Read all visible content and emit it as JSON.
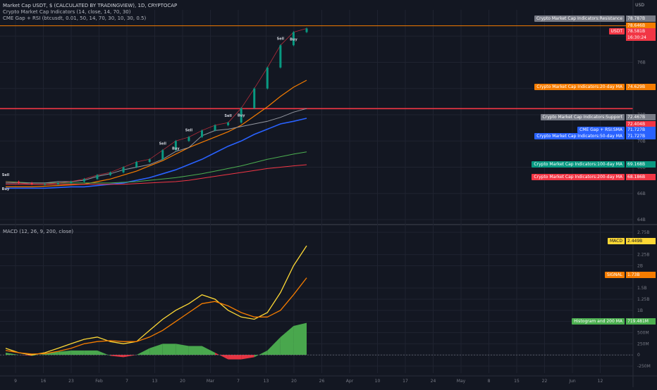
{
  "header": {
    "title": "Market Cap USDT, $ (CALCULATED BY TRADINGVIEW), 1D, CRYPTOCAP",
    "indicator_1": "Crypto Market Cap Indicators (14, close, 14, 70, 30)",
    "indicator_2": "CME Gap + RSI (btcusdt, 0.01, 50, 14, 70, 30, 10, 30, 0.5)",
    "currency": "USD",
    "macd_legend": "MACD (12, 26, 9, 200, close)"
  },
  "price_axis": {
    "ticks": [
      "78B",
      "76B",
      "74B",
      "72B",
      "70B",
      "68B",
      "66B",
      "64B"
    ],
    "labels": [
      {
        "name": "Crypto Market Cap Indicators:Resistance",
        "value": "78.787B",
        "color": "#b2b5be"
      },
      {
        "name": "",
        "value": "78.646B",
        "color": "#f57c00"
      },
      {
        "name": "USDT",
        "value": "78.581B",
        "sub": "16:30:24",
        "color": "#f23645"
      },
      {
        "name": "Crypto Market Cap Indicators:20-day MA",
        "value": "74.629B",
        "color": "#f57c00"
      },
      {
        "name": "Crypto Market Cap Indicators:Support",
        "value": "72.467B",
        "color": "#b2b5be"
      },
      {
        "name": "",
        "value": "72.404B",
        "color": "#f23645"
      },
      {
        "name": "CME Gap + RSI:SMA",
        "value": "71.727B",
        "color": "#2962ff"
      },
      {
        "name": "Crypto Market Cap Indicators:50-day MA",
        "value": "71.727B",
        "color": "#2962ff"
      },
      {
        "name": "Crypto Market Cap Indicators:100-day MA",
        "value": "69.168B",
        "color": "#089981"
      },
      {
        "name": "Crypto Market Cap Indicators:200-day MA",
        "value": "68.186B",
        "color": "#f23645"
      }
    ]
  },
  "macd_axis": {
    "ticks": [
      "2.75B",
      "2.25B",
      "2B",
      "1.5B",
      "1.25B",
      "1B",
      "750M",
      "500M",
      "250M",
      "0",
      "-250M"
    ],
    "labels": [
      {
        "name": "MACD",
        "value": "2.449B",
        "color": "#fdd835"
      },
      {
        "name": "SIGNAL",
        "value": "1.73B",
        "color": "#f57c00"
      },
      {
        "name": "Histogram and 200 MA",
        "value": "719.481M",
        "color": "#4caf50"
      }
    ]
  },
  "time_axis": {
    "labels": [
      "9",
      "16",
      "23",
      "Feb",
      "7",
      "13",
      "20",
      "Mar",
      "7",
      "13",
      "20",
      "26",
      "Apr",
      "10",
      "17",
      "24",
      "May",
      "8",
      "15",
      "22",
      "Jun",
      "12"
    ]
  },
  "signals": {
    "buy": "Buy",
    "sell": "Sell"
  },
  "chart_data": [
    {
      "type": "line",
      "title": "Market Cap USDT",
      "ylabel": "USD",
      "ylim": [
        64,
        80
      ],
      "x": [
        "Jan 6",
        "Jan 9",
        "Jan 12",
        "Jan 16",
        "Jan 19",
        "Jan 23",
        "Jan 26",
        "Feb 1",
        "Feb 4",
        "Feb 7",
        "Feb 10",
        "Feb 13",
        "Feb 16",
        "Feb 20",
        "Feb 23",
        "Mar 1",
        "Mar 4",
        "Mar 7",
        "Mar 10",
        "Mar 13",
        "Mar 16",
        "Mar 20",
        "Mar 23",
        "Mar 25"
      ],
      "series": [
        {
          "name": "USDT",
          "values": [
            66.9,
            66.8,
            66.7,
            66.7,
            66.8,
            66.9,
            67.1,
            67.4,
            67.6,
            68.0,
            68.4,
            68.6,
            69.3,
            70.0,
            70.3,
            70.8,
            71.2,
            71.4,
            72.5,
            74.0,
            75.6,
            77.3,
            78.3,
            78.58
          ]
        },
        {
          "name": "20-day MA",
          "values": [
            66.5,
            66.5,
            66.5,
            66.55,
            66.6,
            66.65,
            66.7,
            66.9,
            67.1,
            67.4,
            67.7,
            68.1,
            68.5,
            69.0,
            69.5,
            69.9,
            70.3,
            70.7,
            71.2,
            71.9,
            72.6,
            73.4,
            74.1,
            74.63
          ]
        },
        {
          "name": "50-day MA",
          "values": [
            66.4,
            66.4,
            66.4,
            66.4,
            66.45,
            66.5,
            66.5,
            66.6,
            66.7,
            66.8,
            67.0,
            67.2,
            67.5,
            67.8,
            68.2,
            68.6,
            69.1,
            69.6,
            70.0,
            70.5,
            70.9,
            71.3,
            71.5,
            71.73
          ]
        },
        {
          "name": "100-day MA",
          "values": [
            66.9,
            66.85,
            66.8,
            66.8,
            66.8,
            66.8,
            66.8,
            66.8,
            66.8,
            66.85,
            66.9,
            67.0,
            67.1,
            67.2,
            67.35,
            67.5,
            67.7,
            67.9,
            68.1,
            68.35,
            68.6,
            68.8,
            69.0,
            69.17
          ]
        },
        {
          "name": "200-day MA",
          "values": [
            66.7,
            66.7,
            66.7,
            66.7,
            66.7,
            66.7,
            66.7,
            66.7,
            66.7,
            66.7,
            66.75,
            66.8,
            66.85,
            66.9,
            67.0,
            67.15,
            67.3,
            67.45,
            67.6,
            67.75,
            67.9,
            68.0,
            68.1,
            68.19
          ]
        },
        {
          "name": "CME Gap + RSI",
          "values": [
            66.8,
            66.8,
            66.8,
            66.8,
            66.9,
            66.9,
            67.0,
            67.3,
            67.5,
            67.8,
            68.0,
            68.2,
            68.6,
            69.2,
            69.5,
            70.4,
            70.8,
            70.9,
            71.1,
            71.3,
            71.5,
            71.8,
            72.2,
            72.47
          ]
        }
      ],
      "horizontal_lines": [
        {
          "name": "Resistance",
          "value": 78.787
        },
        {
          "name": "Support",
          "value": 72.467
        }
      ]
    },
    {
      "type": "area",
      "title": "MACD (12, 26, 9, 200, close)",
      "ylim": [
        -0.25,
        2.75
      ],
      "x": [
        "Jan 6",
        "Jan 9",
        "Jan 12",
        "Jan 16",
        "Jan 19",
        "Jan 23",
        "Jan 26",
        "Feb 1",
        "Feb 4",
        "Feb 7",
        "Feb 10",
        "Feb 13",
        "Feb 16",
        "Feb 20",
        "Feb 23",
        "Mar 1",
        "Mar 4",
        "Mar 7",
        "Mar 10",
        "Mar 13",
        "Mar 16",
        "Mar 20",
        "Mar 23",
        "Mar 25"
      ],
      "series": [
        {
          "name": "MACD",
          "values": [
            0.15,
            0.05,
            0.0,
            0.05,
            0.15,
            0.25,
            0.35,
            0.4,
            0.3,
            0.25,
            0.3,
            0.55,
            0.8,
            1.0,
            1.15,
            1.35,
            1.25,
            1.0,
            0.85,
            0.8,
            0.95,
            1.4,
            2.0,
            2.449
          ]
        },
        {
          "name": "SIGNAL",
          "values": [
            0.1,
            0.05,
            0.02,
            0.03,
            0.08,
            0.15,
            0.25,
            0.3,
            0.32,
            0.3,
            0.3,
            0.4,
            0.55,
            0.75,
            0.95,
            1.15,
            1.2,
            1.1,
            0.95,
            0.85,
            0.85,
            1.0,
            1.35,
            1.73
          ]
        },
        {
          "name": "Histogram",
          "values": [
            0.05,
            0.0,
            -0.02,
            0.02,
            0.07,
            0.1,
            0.1,
            0.1,
            -0.02,
            -0.05,
            0.0,
            0.15,
            0.25,
            0.25,
            0.2,
            0.2,
            0.05,
            -0.1,
            -0.1,
            -0.05,
            0.1,
            0.4,
            0.65,
            0.72
          ]
        }
      ]
    }
  ]
}
